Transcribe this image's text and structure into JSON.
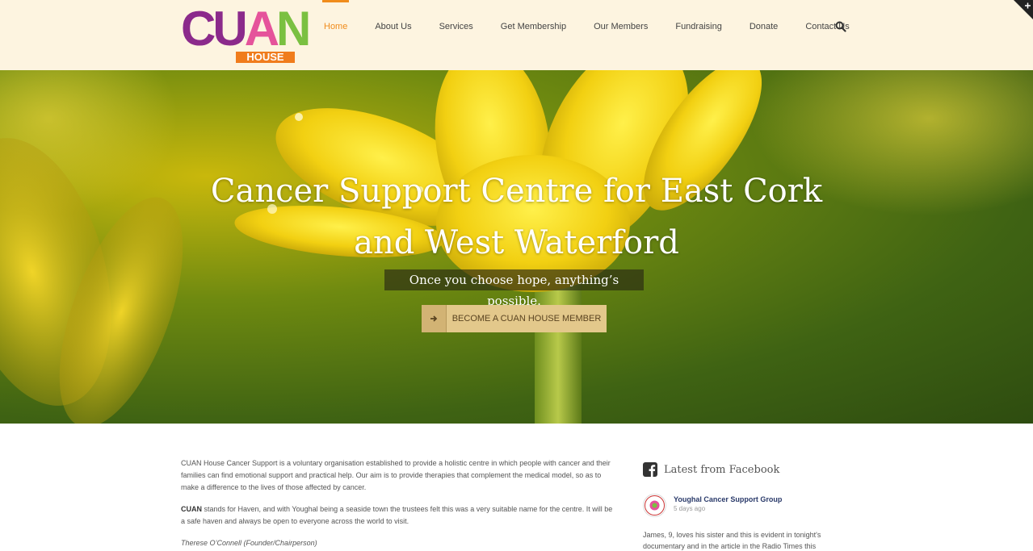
{
  "logo": {
    "word": [
      "C",
      "U",
      "A",
      "N"
    ],
    "sub": "HOUSE",
    "letter_colors": [
      "#8b2a8b",
      "#8b2a8b",
      "#e5539b",
      "#7ac041"
    ]
  },
  "nav": {
    "items": [
      {
        "label": "Home"
      },
      {
        "label": "About Us"
      },
      {
        "label": "Services"
      },
      {
        "label": "Get Membership"
      },
      {
        "label": "Our Members"
      },
      {
        "label": "Fundraising"
      },
      {
        "label": "Donate"
      },
      {
        "label": "Contact Us"
      }
    ],
    "active_index": 0,
    "accent_color": "#f08c1c",
    "search_icon": "search-icon"
  },
  "hero": {
    "title_line1": "Cancer Support Centre for East Cork",
    "title_line2": "and West Waterford",
    "subtitle": "Once you choose hope, anything’s possible.",
    "cta_label": "BECOME A CUAN HOUSE MEMBER",
    "cta_icon": "arrow-right-icon"
  },
  "intro": {
    "p1": "CUAN House Cancer Support is a voluntary organisation established to provide a holistic centre in which people with cancer and their families can find emotional support and practical help.  Our aim is to provide therapies that complement the medical model, so as to make a difference to the lives of those affected by cancer.",
    "p2_bold": "CUAN",
    "p2_rest": "  stands for Haven, and with Youghal being a seaside town the trustees felt this was a very suitable name for the centre. It will be a safe haven and always be open to everyone across the world to visit.",
    "signature": "Therese O’Connell (Founder/Chairperson)"
  },
  "facebook": {
    "heading": "Latest from Facebook",
    "page_name": "Youghal Cancer Support Group",
    "post_date": "5 days ago",
    "post_text": "James, 9, loves his sister and this is evident in tonight's documentary and in the article in the Radio Times this"
  }
}
